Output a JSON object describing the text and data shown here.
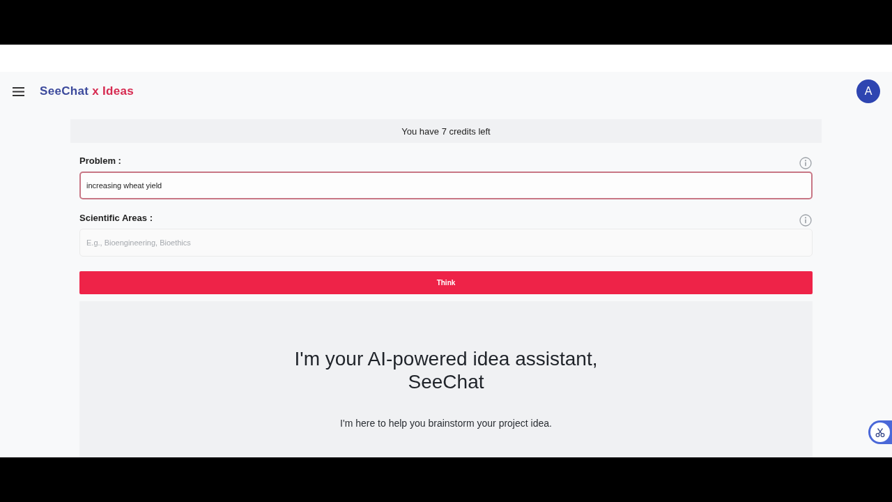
{
  "header": {
    "logo": {
      "brand": "SeeChat",
      "suffix": "x Ideas"
    },
    "avatar": "A"
  },
  "credits_banner": "You have 7 credits left",
  "form": {
    "fields": [
      {
        "label": "Problem :",
        "value": "increasing wheat yield",
        "focused": true
      },
      {
        "label": "Scientific Areas :",
        "placeholder": "E.g., Bioengineering, Bioethics",
        "focused": false
      }
    ],
    "submit": "Think"
  },
  "welcome": {
    "heading": "I'm your AI-powered idea assistant, SeeChat",
    "subtext": "I'm here to help you brainstorm your project idea."
  }
}
